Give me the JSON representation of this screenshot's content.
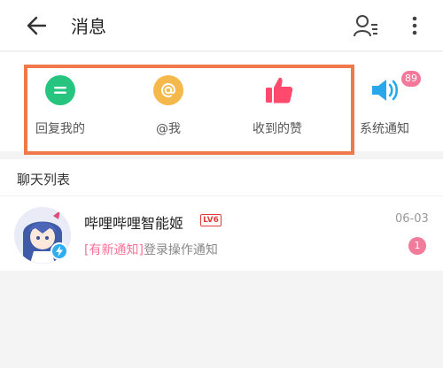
{
  "header": {
    "title": "消息"
  },
  "categories": [
    {
      "label": "回复我的",
      "icon": "reply-icon",
      "color": "#27c47f"
    },
    {
      "label": "@我",
      "icon": "at-icon",
      "color": "#f5b84a"
    },
    {
      "label": "收到的赞",
      "icon": "thumbs-up-icon",
      "color": "#ff4a6d"
    },
    {
      "label": "系统通知",
      "icon": "speaker-icon",
      "color": "#29a7ea",
      "badge": "89"
    }
  ],
  "section": {
    "title": "聊天列表"
  },
  "chats": [
    {
      "name": "哔哩哔哩智能姬",
      "level": "LV6",
      "tag": "[有新通知]",
      "message": "登录操作通知",
      "date": "06-03",
      "unread": "1"
    }
  ],
  "colors": {
    "accent_pink": "#fb7299",
    "highlight_border": "#f0784a"
  }
}
